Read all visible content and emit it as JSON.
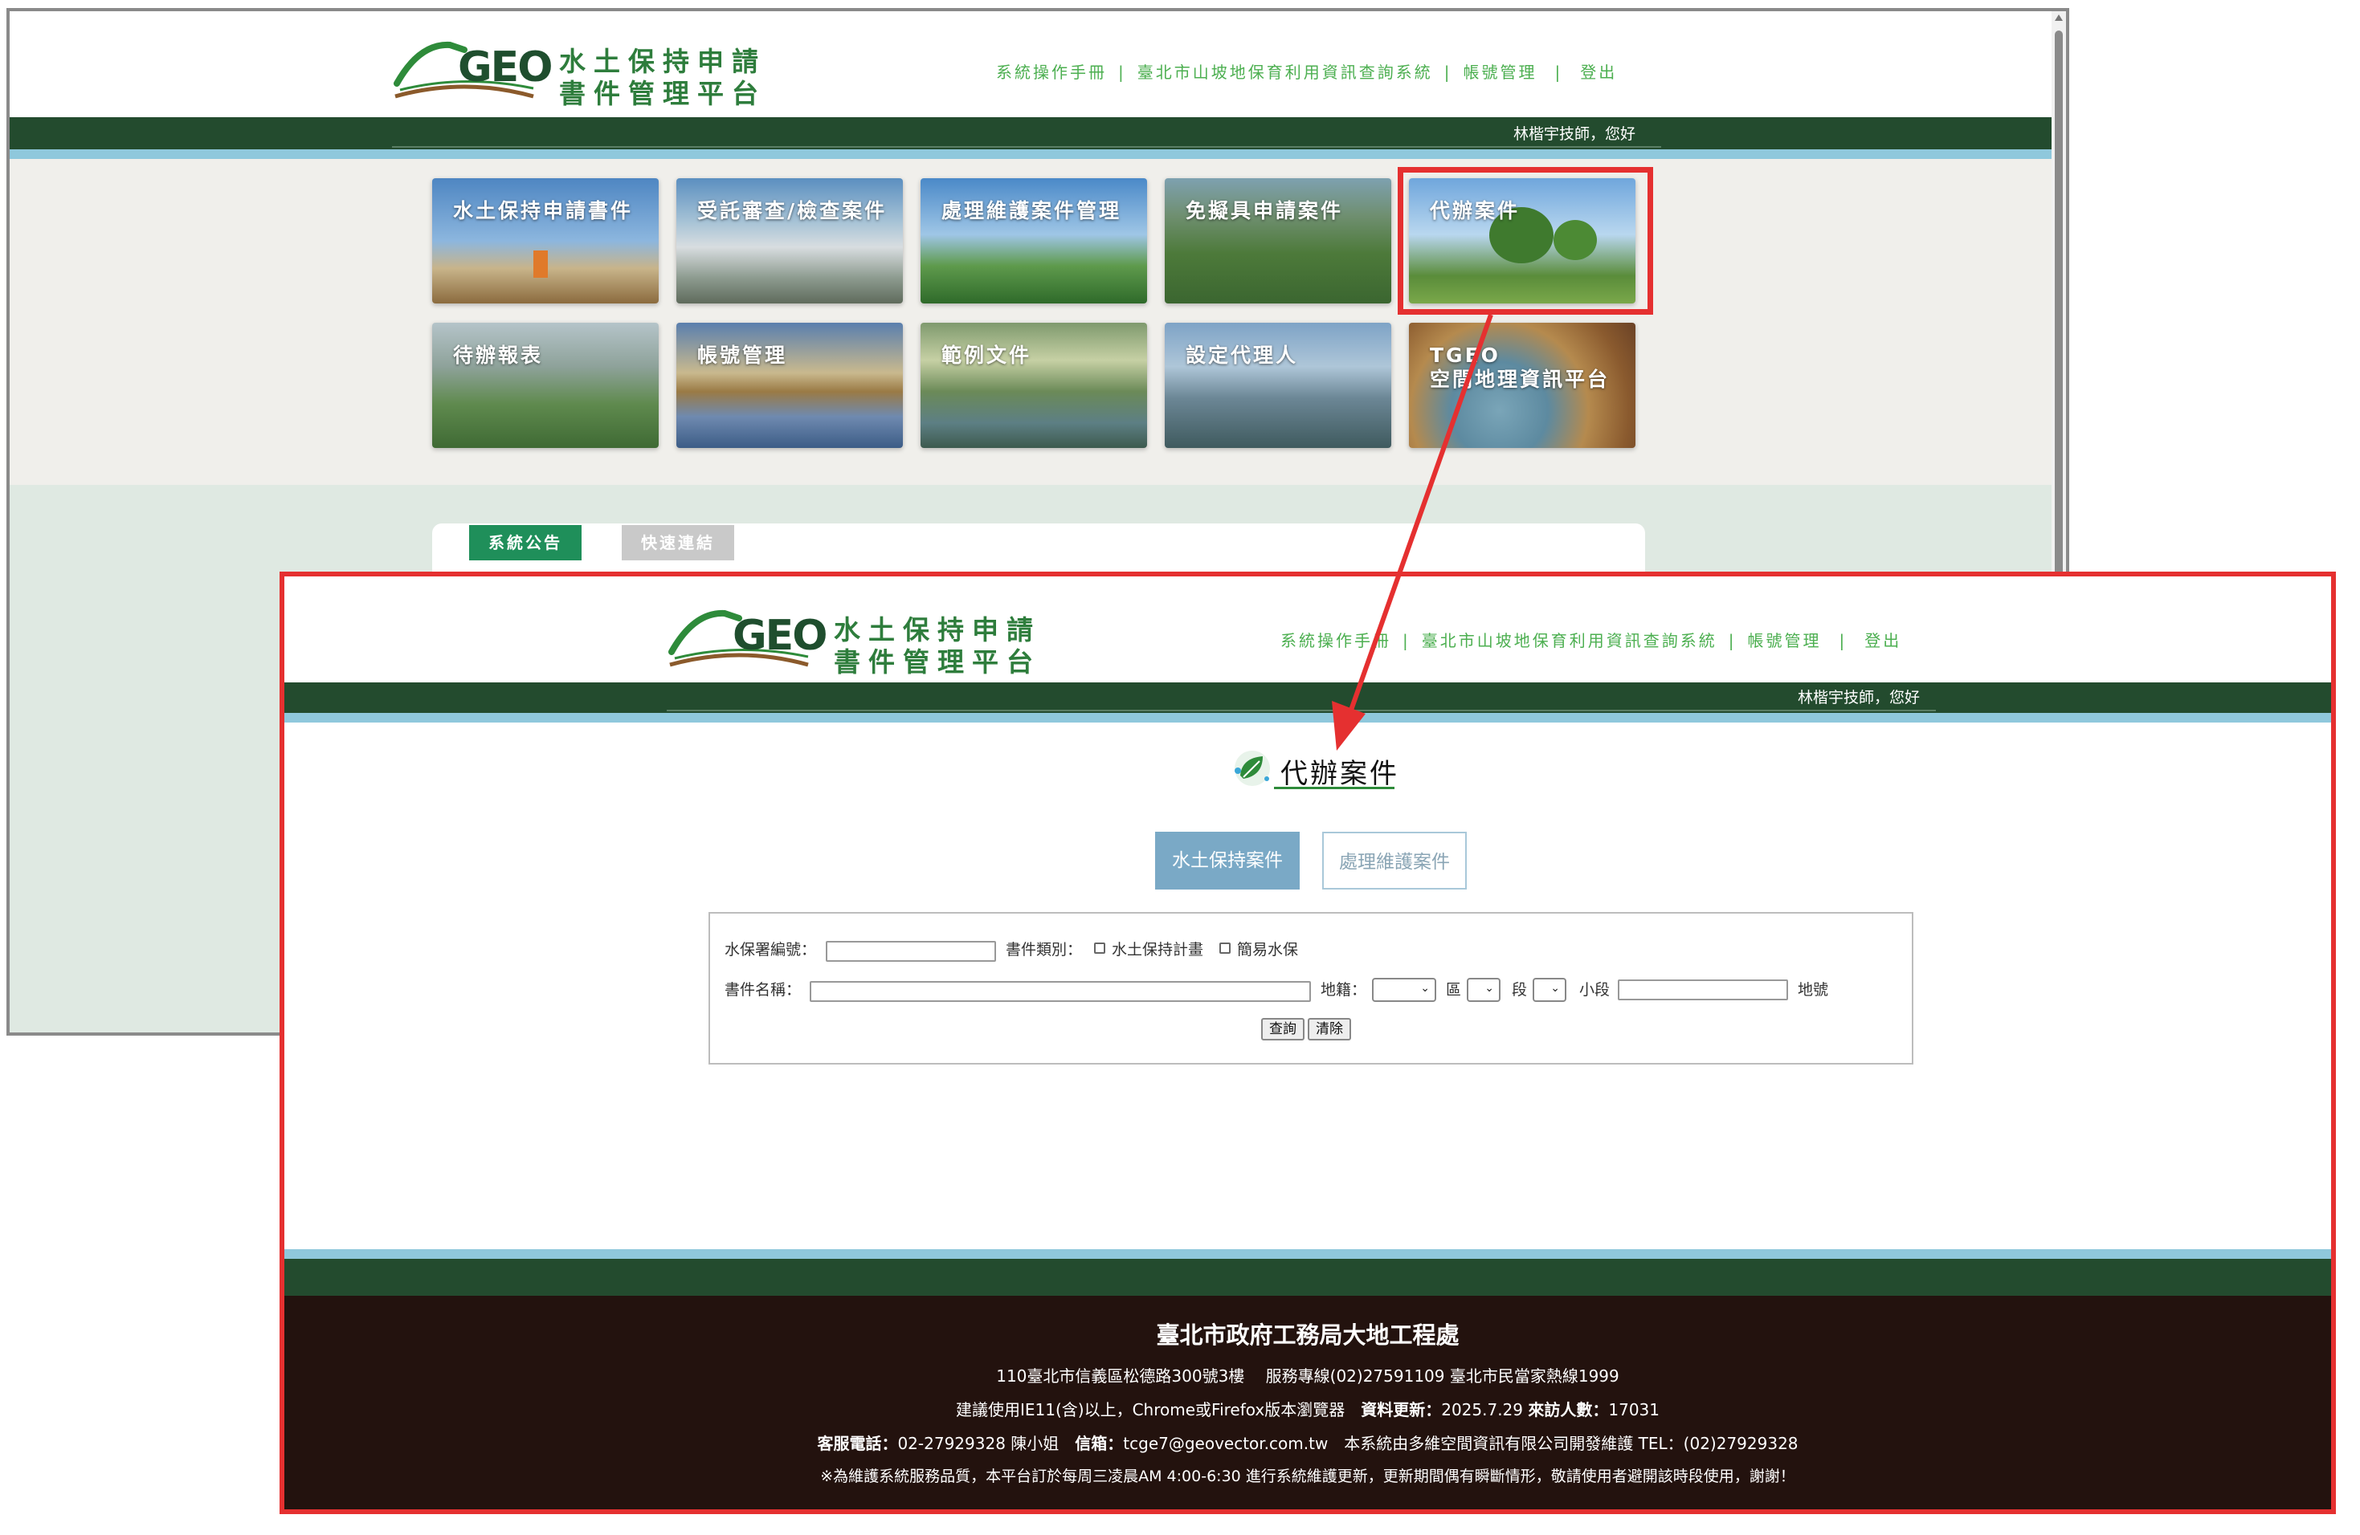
{
  "brand": {
    "logo_text": "GEO",
    "title_line1": "水土保持申請",
    "title_line2": "書件管理平台"
  },
  "top_nav": {
    "manual": "系統操作手冊",
    "slope_query": "臺北市山坡地保育利用資訊查詢系統",
    "account": "帳號管理",
    "logout": "登出",
    "separator": "|"
  },
  "user_greeting": "林楷宇技師，您好",
  "tiles": [
    {
      "label": "水土保持申請書件"
    },
    {
      "label": "受託審查/檢查案件"
    },
    {
      "label": "處理維護案件管理"
    },
    {
      "label": "免擬具申請案件"
    },
    {
      "label": "代辦案件"
    },
    {
      "label": "待辦報表"
    },
    {
      "label": "帳號管理"
    },
    {
      "label": "範例文件"
    },
    {
      "label": "設定代理人"
    },
    {
      "label": "TGEO\n空間地理資訊平台"
    }
  ],
  "bottom_tabs": {
    "announcements": "系統公告",
    "quick_links": "快速連結"
  },
  "detail_page": {
    "heading": "代辦案件",
    "tab_swc": "水土保持案件",
    "tab_maintenance": "處理維護案件",
    "form": {
      "case_no_label": "水保署編號：",
      "doc_type_label": "書件類別：",
      "doc_type_option1": "水土保持計畫",
      "doc_type_option2": "簡易水保",
      "doc_name_label": "書件名稱：",
      "land_label": "地籍：",
      "district_label": "區",
      "section_label": "段",
      "subsection_label": "小段",
      "lot_label": "地號",
      "search_button": "查詢",
      "clear_button": "清除"
    }
  },
  "footer": {
    "org": "臺北市政府工務局大地工程處",
    "line1": "110臺北市信義區松德路300號3樓　 服務專線(02)27591109 臺北市民當家熱線1999",
    "line2_a": "建議使用IE11(含)以上，Chrome或Firefox版本瀏覽器　",
    "line2_update_label": "資料更新：",
    "line2_update_value": "2025.7.29 ",
    "line2_visitors_label": "來訪人數：",
    "line2_visitors_value": "17031",
    "line3_phone_label": "客服電話：",
    "line3_phone_value": "02-27929328 陳小姐　",
    "line3_email_label": "信箱：",
    "line3_email_value": "tcge7@geovector.com.tw",
    "line3_dev": "　本系統由多維空間資訊有限公司開發維護 TEL：(02)27929328",
    "line4": "※為維護系統服務品質，本平台訂於每周三凌晨AM 4:00-6:30 進行系統維護更新，更新期間偶有瞬斷情形，敬請使用者避開該時段使用，謝謝！"
  },
  "colors": {
    "dark_green": "#234b2e",
    "light_blue": "#8fc8dc",
    "footer_brown": "#23120e",
    "nav_green": "#4caf50",
    "highlight_red": "#e53030",
    "button_blue": "#7aa9c6"
  }
}
